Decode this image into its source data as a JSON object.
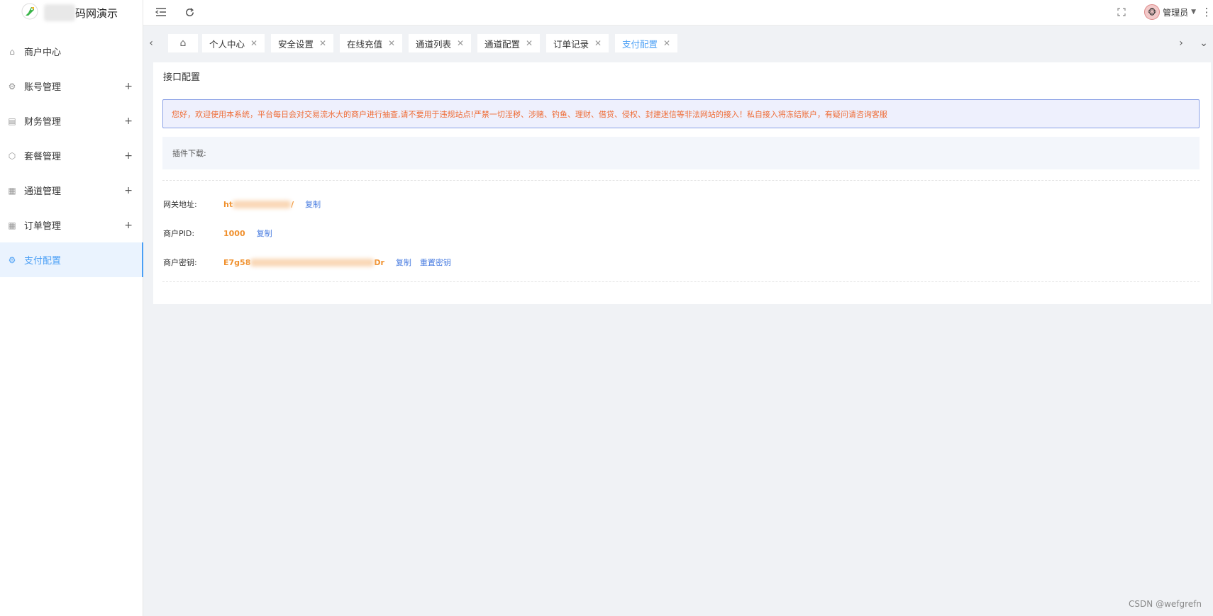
{
  "app": {
    "logo_text": "码网演示"
  },
  "sidebar": {
    "items": [
      {
        "label": "商户中心",
        "icon": "home-icon",
        "expandable": false
      },
      {
        "label": "账号管理",
        "icon": "gear-icon",
        "expandable": true
      },
      {
        "label": "财务管理",
        "icon": "finance-icon",
        "expandable": true
      },
      {
        "label": "套餐管理",
        "icon": "cube-icon",
        "expandable": true
      },
      {
        "label": "通道管理",
        "icon": "grid-icon",
        "expandable": true
      },
      {
        "label": "订单管理",
        "icon": "grid-icon",
        "expandable": true
      },
      {
        "label": "支付配置",
        "icon": "gear-icon",
        "expandable": false,
        "active": true
      }
    ],
    "expand_symbol": "+"
  },
  "header": {
    "user_name": "管理员"
  },
  "tabs": [
    {
      "label": "个人中心"
    },
    {
      "label": "安全设置"
    },
    {
      "label": "在线充值"
    },
    {
      "label": "通道列表"
    },
    {
      "label": "通道配置"
    },
    {
      "label": "订单记录"
    },
    {
      "label": "支付配置",
      "active": true
    }
  ],
  "card": {
    "title": "接口配置",
    "notice": "您好，欢迎使用本系统，平台每日会对交易流水大的商户进行抽查,请不要用于违规站点!严禁一切淫秽、涉赌、钓鱼、理财、借贷、侵权、封建迷信等非法网站的接入！私自接入将冻结账户，有疑问请咨询客服",
    "plugin_label": "插件下载:",
    "gateway": {
      "label": "网关地址:",
      "value_prefix": "ht",
      "value_suffix": "/",
      "copy": "复制"
    },
    "pid": {
      "label": "商户PID:",
      "value": "1000",
      "copy": "复制"
    },
    "key": {
      "label": "商户密钥:",
      "value_prefix": "E7g58",
      "value_suffix": "Dr",
      "copy": "复制",
      "reset": "重置密钥"
    }
  },
  "watermark": "CSDN @wefgrefn",
  "colors": {
    "accent": "#4a9ff5",
    "warning_text": "#ef6b35",
    "value": "#f0902d",
    "link": "#4a7de0"
  }
}
